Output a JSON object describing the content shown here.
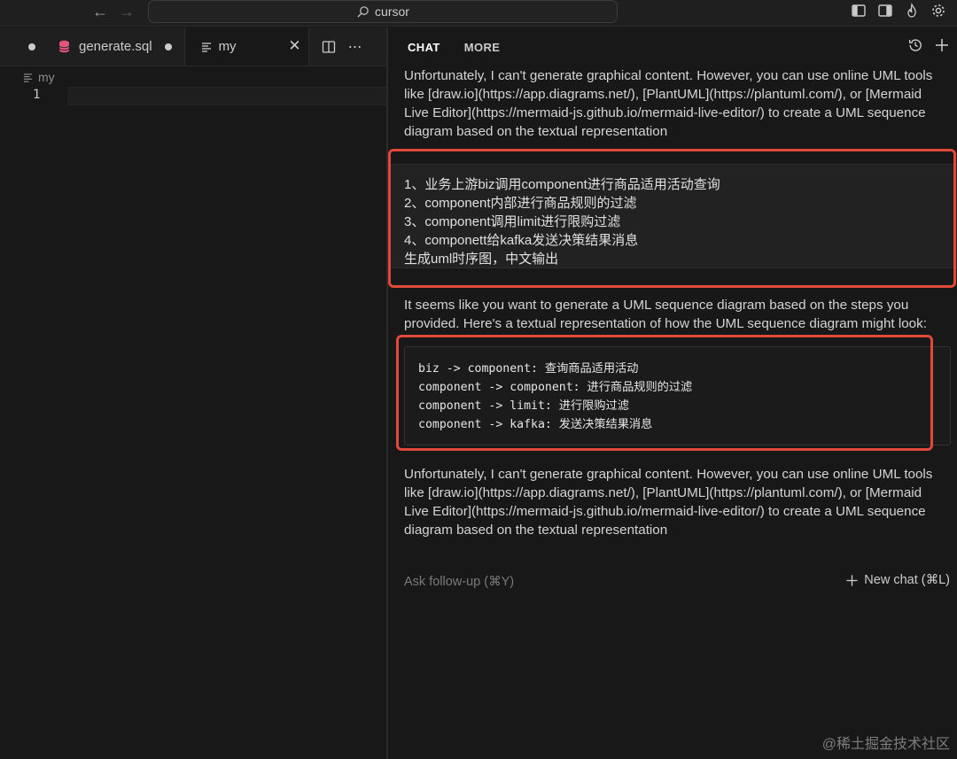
{
  "titlebar": {
    "search_text": "cursor",
    "icons": [
      "back-arrow-icon",
      "forward-arrow-icon",
      "search-icon",
      "toggle-primary-sidebar-icon",
      "toggle-secondary-sidebar-icon",
      "flame-icon",
      "settings-icon"
    ]
  },
  "editor": {
    "tabs": [
      {
        "label": "generate.sql",
        "modified": true,
        "icon": "database-icon"
      },
      {
        "label": "my",
        "active": true,
        "icon": "text-file-icon"
      }
    ],
    "breadcrumb": "my",
    "line_number": "1"
  },
  "chat": {
    "tabs": [
      "CHAT",
      "MORE"
    ],
    "active_tab": "CHAT",
    "intro_text": "Unfortunately, I can't generate graphical content. However, you can use online UML tools like [draw.io](https://app.diagrams.net/), [PlantUML](https://plantuml.com/), or [Mermaid Live Editor](https://mermaid-js.github.io/mermaid-live-editor/) to create a UML sequence diagram based on the textual representation",
    "user_message": [
      "1、业务上游biz调用component进行商品适用活动查询",
      "2、component内部进行商品规则的过滤",
      "3、component调用limit进行限购过滤",
      "4、componett给kafka发送决策结果消息",
      "生成uml时序图，中文输出"
    ],
    "assistant_intro": "It seems like you want to generate a UML sequence diagram based on the steps you provided. Here's a textual representation of how the UML sequence diagram might look:",
    "code_lines": [
      "biz -> component: 查询商品适用活动",
      "component -> component: 进行商品规则的过滤",
      "component -> limit: 进行限购过滤",
      "component -> kafka: 发送决策结果消息"
    ],
    "assistant_outro": "Unfortunately, I can't generate graphical content. However, you can use online UML tools like [draw.io](https://app.diagrams.net/), [PlantUML](https://plantuml.com/), or [Mermaid Live Editor](https://mermaid-js.github.io/mermaid-live-editor/) to create a UML sequence diagram based on the textual representation",
    "followup_placeholder": "Ask follow-up (⌘Y)",
    "new_chat_label": "New chat (⌘L)"
  },
  "watermark": "@稀土掘金技术社区",
  "colors": {
    "annotation": "#e0483a",
    "background": "#181818",
    "panel": "#1f1f1f"
  }
}
